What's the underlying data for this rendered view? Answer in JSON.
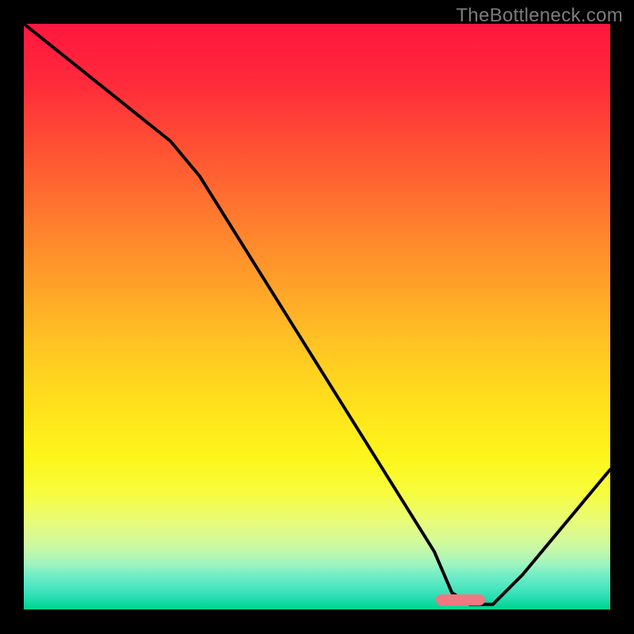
{
  "watermark": "TheBottleneck.com",
  "colors": {
    "gradient_top": "#ff173f",
    "gradient_mid": "#ffe31c",
    "gradient_bottom": "#00d58e",
    "curve": "#000000",
    "marker": "#ef7882",
    "frame": "#000000"
  },
  "chart_data": {
    "type": "line",
    "title": "",
    "xlabel": "",
    "ylabel": "",
    "xlim": [
      0,
      100
    ],
    "ylim": [
      0,
      100
    ],
    "grid": false,
    "legend": false,
    "x": [
      0,
      5,
      10,
      15,
      20,
      25,
      30,
      35,
      40,
      45,
      50,
      55,
      60,
      65,
      70,
      73,
      76,
      80,
      85,
      90,
      95,
      100
    ],
    "values": [
      100,
      96,
      92,
      88,
      84,
      80,
      74,
      66,
      58,
      50,
      42,
      34,
      26,
      18,
      10,
      3,
      1,
      1,
      6,
      12,
      18,
      24
    ],
    "marker": {
      "x_center": 74.5,
      "y_center": 1.7,
      "shape": "pill"
    },
    "notes": "Values are estimated from the image; y represents vertical position along the gradient (0 = bottom, 100 = top)."
  }
}
